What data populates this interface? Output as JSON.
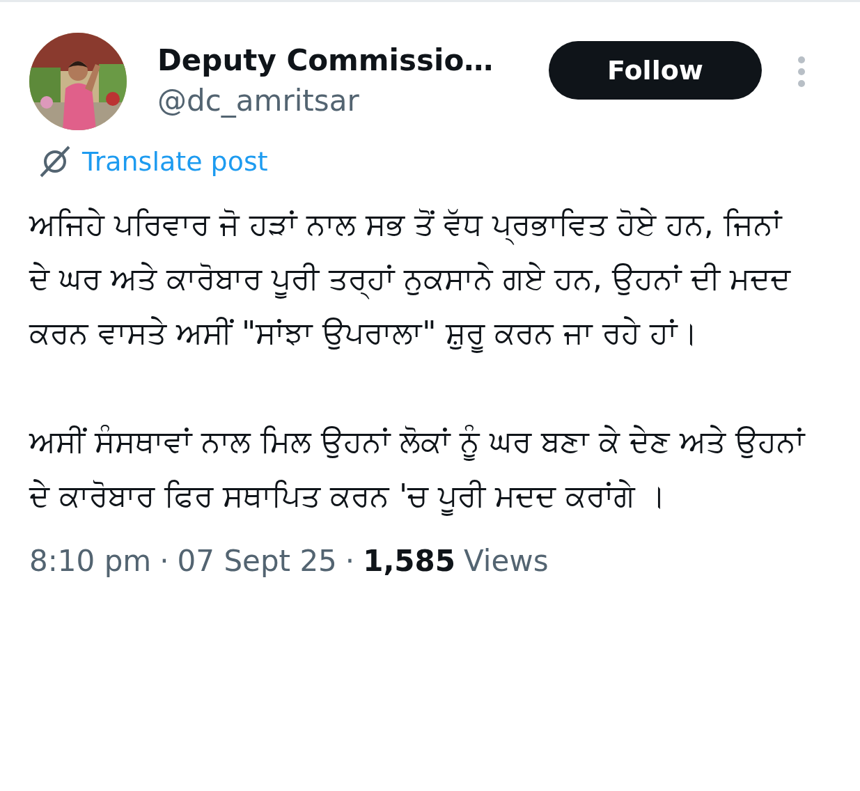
{
  "author": {
    "name": "Deputy Commissio…",
    "handle": "@dc_amritsar"
  },
  "follow_button": "Follow",
  "translate": "Translate post",
  "paragraphs": [
    "ਅਜਿਹੇ ਪਰਿਵਾਰ ਜੋ ਹੜਾਂ ਨਾਲ ਸਭ ਤੋਂ ਵੱਧ ਪ੍ਰਭਾਵਿਤ ਹੋਏ ਹਨ, ਜਿਨਾਂ ਦੇ ਘਰ ਅਤੇ ਕਾਰੋਬਾਰ ਪੂਰੀ ਤਰ੍ਹਾਂ ਨੁਕਸਾਨੇ ਗਏ ਹਨ, ਉਹਨਾਂ ਦੀ ਮਦਦ ਕਰਨ ਵਾਸਤੇ ਅਸੀਂ \"ਸਾਂਝਾ ਉਪਰਾਲਾ\" ਸ਼ੁਰੂ ਕਰਨ ਜਾ ਰਹੇ ਹਾਂ।",
    "ਅਸੀਂ ਸੰਸਥਾਵਾਂ ਨਾਲ ਮਿਲ ਉਹਨਾਂ ਲੋਕਾਂ ਨੂੰ ਘਰ ਬਣਾ ਕੇ ਦੇਣ ਅਤੇ ਉਹਨਾਂ ਦੇ ਕਾਰੋਬਾਰ ਫਿਰ ਸਥਾਪਿਤ ਕਰਨ 'ਚ ਪੂਰੀ ਮਦਦ ਕਰਾਂਗੇ ।"
  ],
  "meta": {
    "time": "8:10 pm",
    "separator_1": "·",
    "date": "07 Sept 25",
    "separator_2": "·",
    "views_count": "1,585",
    "views_label": "Views"
  }
}
